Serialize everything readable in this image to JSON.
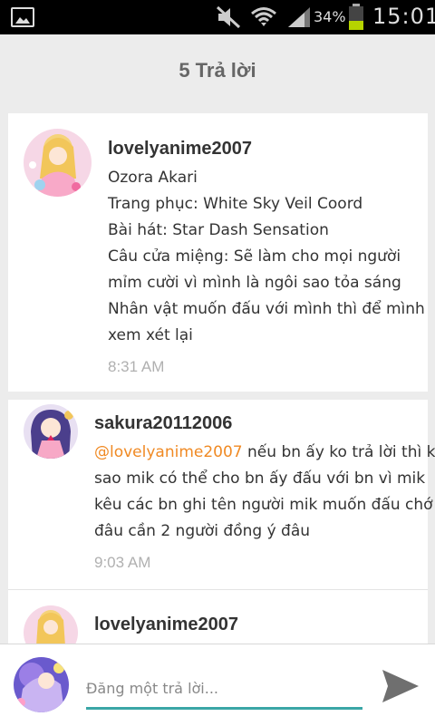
{
  "status_bar": {
    "battery_percent": "34%",
    "time": "15:01",
    "icons": [
      "gallery-icon",
      "mute-icon",
      "wifi-icon",
      "signal-icon",
      "battery-icon"
    ]
  },
  "header": {
    "title": "5 Trả lời"
  },
  "replies": [
    {
      "username": "lovelyanime2007",
      "lines": [
        "Ozora Akari",
        "Trang phục: White Sky Veil Coord",
        "Bài hát: Star Dash Sensation",
        "Câu cửa miệng: Sẽ làm cho mọi người",
        "mỉm cười vì mình là ngôi sao tỏa sáng",
        "Nhân vật muốn đấu với mình thì để mình",
        "xem xét lại"
      ],
      "timestamp": "8:31 AM"
    },
    {
      "username": "sakura20112006",
      "mention": "@lovelyanime2007",
      "first_line_rest": " nếu bn ấy ko trả lời thì ko",
      "lines": [
        "sao mik có thể cho bn ấy đấu với bn vì mik",
        "kêu các bn ghi tên người mik muốn đấu chớ",
        "đâu cần 2 người đồng ý đâu"
      ],
      "timestamp": "9:03 AM"
    },
    {
      "username": "lovelyanime2007"
    }
  ],
  "composer": {
    "placeholder": "Đăng một trả lời...",
    "accent_color": "#3aa6a6",
    "send_icon": "send-icon"
  },
  "colors": {
    "mention": "#f08a24",
    "timestamp": "#b0b0b0",
    "background": "#ececec"
  }
}
